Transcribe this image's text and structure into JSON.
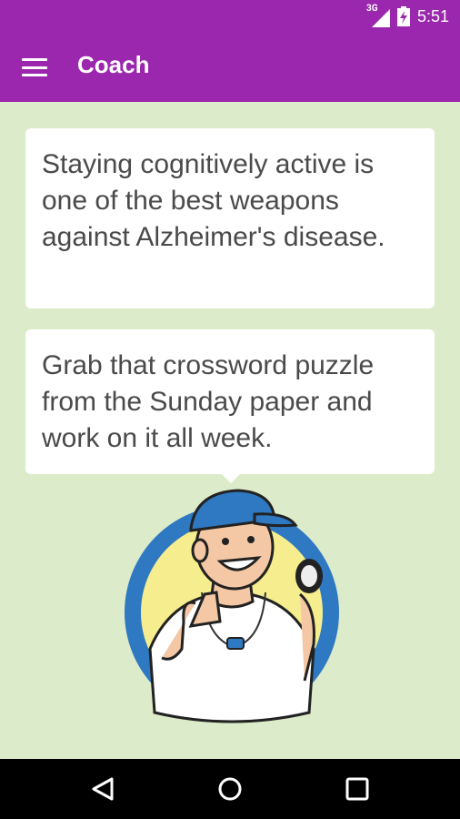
{
  "status_bar": {
    "network_type": "3G",
    "time": "5:51",
    "icons": [
      "signal-icon",
      "battery-icon"
    ]
  },
  "app_bar": {
    "menu_icon": "hamburger-menu-icon",
    "title": "Coach",
    "color": "#9a27ad"
  },
  "messages": [
    {
      "text": "Staying cognitively active is one of the best weapons against Alzheimer's disease."
    },
    {
      "text": "Grab that crossword puzzle from the Sunday paper and work on it all week."
    }
  ],
  "illustration": {
    "icon": "coach-mascot-icon"
  },
  "nav_bar": {
    "icons": [
      "back-icon",
      "home-icon",
      "recents-icon"
    ]
  },
  "colors": {
    "background": "#dcebca",
    "card": "#ffffff",
    "text": "#4a4a4a"
  }
}
